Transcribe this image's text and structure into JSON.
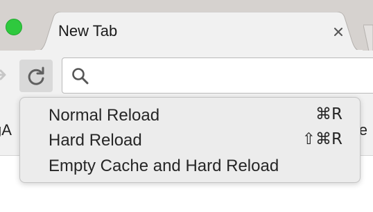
{
  "window": {
    "controls": [
      "close-button"
    ]
  },
  "tabs": [
    {
      "label": "New Tab",
      "active": true
    }
  ],
  "toolbar": {
    "icons": [
      "forward-arrow-icon",
      "reload-icon",
      "search-icon"
    ],
    "omnibox": {
      "value": "",
      "placeholder": ""
    }
  },
  "bookmarks_bar": {
    "left_fragment": "gA",
    "right_fragment": "ile"
  },
  "reload_menu": {
    "items": [
      {
        "label": "Normal Reload",
        "shortcut": "⌘R"
      },
      {
        "label": "Hard Reload",
        "shortcut": "⇧⌘R"
      },
      {
        "label": "Empty Cache and Hard Reload",
        "shortcut": ""
      }
    ]
  },
  "colors": {
    "titlebar": "#d6d2cf",
    "toolbar": "#f1f1f1",
    "traffic_light_green": "#2fc93e",
    "menu_background": "#ececec"
  }
}
